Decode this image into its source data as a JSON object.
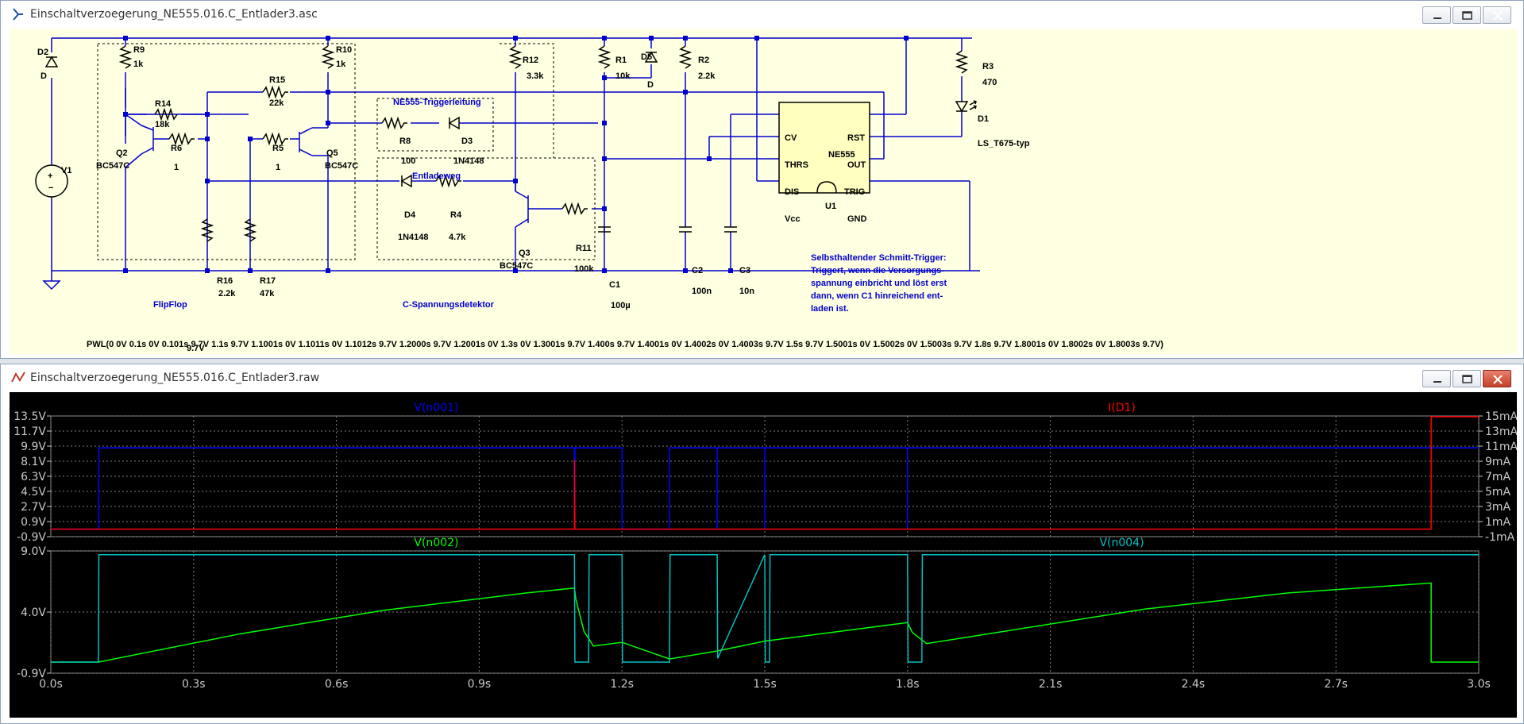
{
  "schematic_window": {
    "title": "Einschaltverzoegerung_NE555.016.C_Entlader3.asc",
    "components": {
      "d2": "D2",
      "d2_val": "D",
      "v1": "V1",
      "r9": "R9",
      "r9_val": "1k",
      "r10": "R10",
      "r10_val": "1k",
      "r15": "R15",
      "r15_val": "22k",
      "r14": "R14",
      "r14_val": "18k",
      "q2": "Q2",
      "q2_val": "BC547C",
      "r6": "R6",
      "r6_val": "1",
      "r5": "R5",
      "r5_val": "1",
      "q5": "Q5",
      "q5_val": "BC547C",
      "r16": "R16",
      "r16_val": "2.2k",
      "r17": "R17",
      "r17_val": "47k",
      "flipflop": "FlipFlop",
      "ne555_trig": "NE555-Triggerleitung",
      "r8": "R8",
      "r8_val": "100",
      "d3": "D3",
      "d3_val": "1N4148",
      "entladeweg": "Entladeweg",
      "d4": "D4",
      "d4_val": "1N4148",
      "r4": "R4",
      "r4_val": "4.7k",
      "r12": "R12",
      "r12_val": "3.3k",
      "q3": "Q3",
      "q3_val": "BC547C",
      "r11": "R11",
      "r11_val": "100k",
      "cdet": "C-Spannungsdetektor",
      "r1": "R1",
      "r1_val": "10k",
      "d5": "D5",
      "d5_val": "D",
      "r2": "R2",
      "r2_val": "2.2k",
      "c1": "C1",
      "c1_val": "100µ",
      "c2": "C2",
      "c2_val": "100n",
      "c3": "C3",
      "c3_val": "10n",
      "r3": "R3",
      "r3_val": "470",
      "d1": "D1",
      "d1_val": "LS_T675-typ",
      "u1": "U1",
      "ne555": "NE555",
      "pin_cv": "CV",
      "pin_thrs": "THRS",
      "pin_dis": "DIS",
      "pin_vcc": "Vcc",
      "pin_rst": "RST",
      "pin_out": "OUT",
      "pin_trig": "TRIG",
      "pin_gnd": "GND"
    },
    "note_lines": [
      "Selbsthaltender Schmitt-Trigger:",
      "Triggert, wenn die Versorgungs-",
      "spannung einbricht und löst erst",
      "dann, wenn C1 hinreichend ent-",
      "laden ist."
    ],
    "pwl": "PWL(0 0V 0.1s 0V 0.101s 9.7V 1.1s 9.7V 1.1001s 0V 1.1011s 0V 1.1012s 9.7V 1.2000s 9.7V 1.2001s 0V 1.3s 0V 1.3001s 9.7V 1.400s 9.7V 1.4001s 0V 1.4002s 0V 1.4003s 9.7V 1.5s 9.7V 1.5001s 0V 1.5002s 0V 1.5003s 9.7V 1.8s 9.7V 1.8001s 0V 1.8002s 0V 1.8003s 9.7V)",
    "pwl_overlap": "9.7V"
  },
  "waveform_window": {
    "title": "Einschaltverzoegerung_NE555.016.C_Entlader3.raw"
  },
  "chart_data": [
    {
      "type": "line",
      "title": "",
      "xlim": [
        0,
        3.0
      ],
      "x_ticks": [
        "0.0s",
        "0.3s",
        "0.6s",
        "0.9s",
        "1.2s",
        "1.5s",
        "1.8s",
        "2.1s",
        "2.4s",
        "2.7s",
        "3.0s"
      ],
      "ylim": [
        -0.9,
        13.5
      ],
      "y_ticks": [
        "13.5V",
        "11.7V",
        "9.9V",
        "8.1V",
        "6.3V",
        "4.5V",
        "2.7V",
        "0.9V",
        "-0.9V"
      ],
      "y2lim": [
        -1,
        15
      ],
      "y2_ticks": [
        "15mA",
        "13mA",
        "11mA",
        "9mA",
        "7mA",
        "5mA",
        "3mA",
        "1mA",
        "-1mA"
      ],
      "grid": true,
      "series": [
        {
          "name": "V(n001)",
          "color": "#0000ff",
          "axis": "left",
          "x": [
            0,
            0.1,
            0.101,
            1.1,
            1.1001,
            1.1011,
            1.1012,
            1.2,
            1.2001,
            1.3,
            1.3001,
            1.4,
            1.4001,
            1.4002,
            1.4003,
            1.5,
            1.5001,
            1.5002,
            1.5003,
            1.8,
            1.8001,
            1.8002,
            1.8003,
            3.0
          ],
          "y": [
            0,
            0,
            9.7,
            9.7,
            0,
            0,
            9.7,
            9.7,
            0,
            0,
            9.7,
            9.7,
            0,
            0,
            9.7,
            9.7,
            0,
            0,
            9.7,
            9.7,
            0,
            0,
            9.7,
            9.7
          ]
        },
        {
          "name": "I(D1)",
          "color": "#ff0000",
          "axis": "right",
          "x": [
            0,
            1.1,
            1.1001,
            1.1011,
            1.1012,
            2.9,
            2.9001,
            3.0
          ],
          "y": [
            0,
            0,
            9.2,
            0,
            0,
            0,
            14.9,
            14.9
          ]
        }
      ]
    },
    {
      "type": "line",
      "title": "",
      "xlim": [
        0,
        3.0
      ],
      "x_ticks": [
        "0.0s",
        "0.3s",
        "0.6s",
        "0.9s",
        "1.2s",
        "1.5s",
        "1.8s",
        "2.1s",
        "2.4s",
        "2.7s",
        "3.0s"
      ],
      "ylim": [
        -0.9,
        9.0
      ],
      "y_ticks": [
        "9.0V",
        "4.0V",
        "-0.9V"
      ],
      "grid": true,
      "series": [
        {
          "name": "V(n002)",
          "color": "#00ff00",
          "x": [
            0,
            0.1,
            0.4,
            0.7,
            1.0,
            1.1,
            1.103,
            1.12,
            1.14,
            1.2,
            1.3,
            1.4,
            1.5,
            1.6,
            1.8,
            1.81,
            1.84,
            2.3,
            2.6,
            2.9,
            2.9001,
            3.0
          ],
          "y": [
            0.0,
            0.0,
            2.3,
            4.2,
            5.6,
            6.0,
            5.1,
            2.5,
            1.3,
            1.6,
            0.25,
            0.9,
            1.7,
            2.2,
            3.2,
            2.4,
            1.5,
            4.3,
            5.6,
            6.4,
            0.0,
            0.0
          ]
        },
        {
          "name": "V(n004)",
          "color": "#00c0c0",
          "x": [
            0,
            0.1,
            0.101,
            1.1,
            1.101,
            1.13,
            1.131,
            1.2,
            1.201,
            1.3,
            1.301,
            1.4,
            1.401,
            1.5,
            1.501,
            1.51,
            1.511,
            1.8,
            1.801,
            1.83,
            1.831,
            3.0
          ],
          "y": [
            0,
            0,
            8.7,
            8.7,
            0,
            0,
            8.7,
            8.7,
            0,
            0,
            8.7,
            8.7,
            0.3,
            8.7,
            0,
            0,
            8.7,
            8.7,
            0,
            0,
            8.7,
            8.7
          ]
        }
      ]
    }
  ]
}
